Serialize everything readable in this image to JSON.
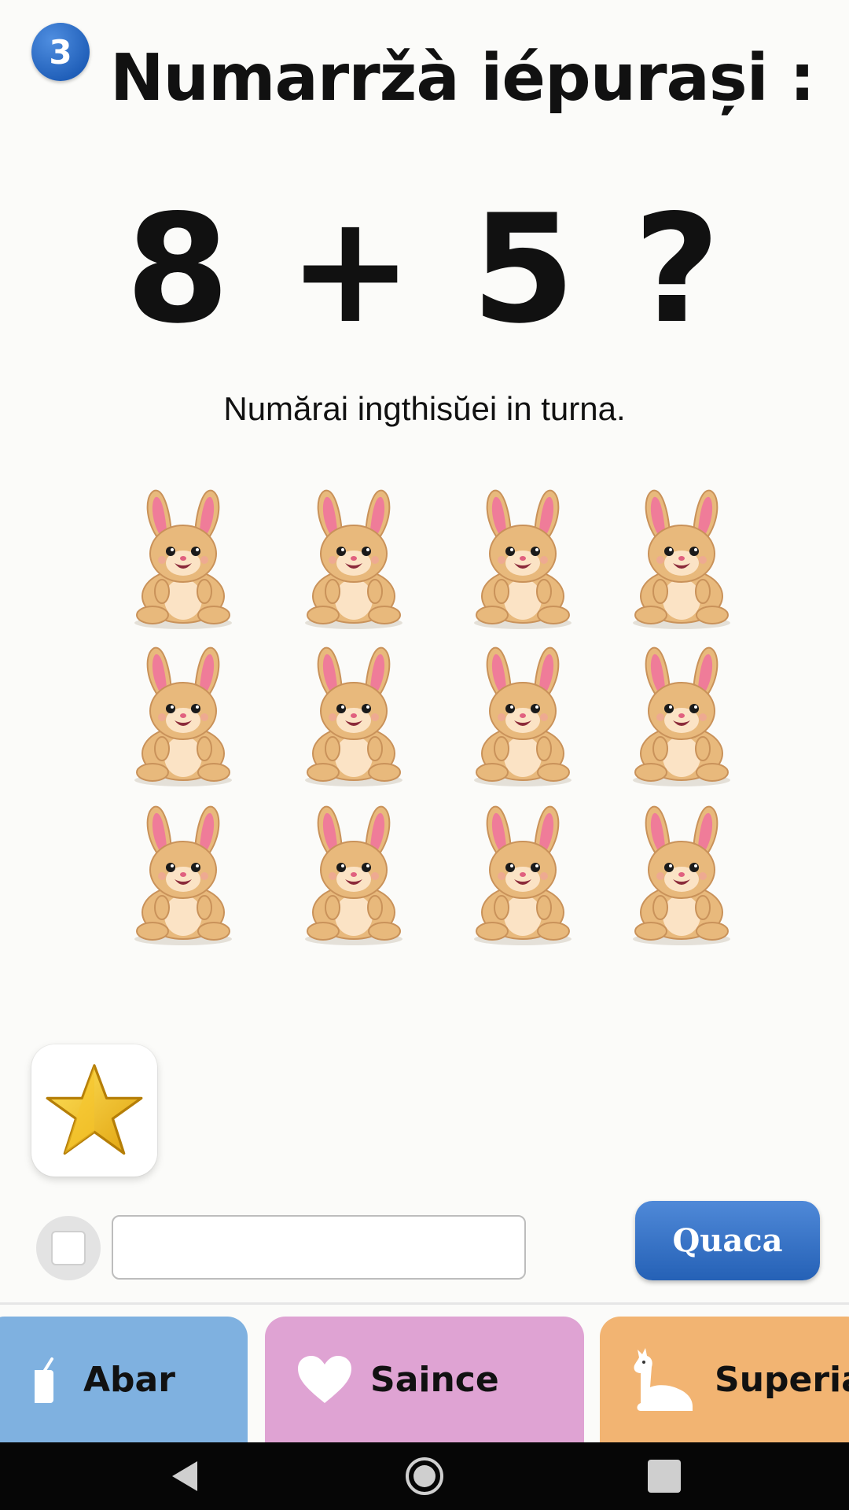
{
  "header": {
    "step_number": "3",
    "title": "Numarržà iépurași :"
  },
  "problem": {
    "equation": "8 + 5 ?",
    "instruction": "Numărai ingthisŭei in turna."
  },
  "bunnies": {
    "rows": 3,
    "columns": 4,
    "icon": "bunny-icon"
  },
  "reward": {
    "icon": "star-icon"
  },
  "answer": {
    "value": "",
    "placeholder": "",
    "check_label": "Quaca"
  },
  "tabs": [
    {
      "label": "Abar",
      "icon": "toy-icon",
      "color": "#7fb1e0"
    },
    {
      "label": "Saince",
      "icon": "heart-icon",
      "color": "#dfa3d3"
    },
    {
      "label": "Superia",
      "icon": "llama-icon",
      "color": "#f2b472"
    }
  ],
  "navbar": {
    "buttons": [
      "back-icon",
      "home-icon",
      "recents-icon"
    ]
  },
  "colors": {
    "accent": "#2561b6",
    "bunny_fur": "#e8b97c",
    "bunny_ear": "#ef7c99"
  }
}
